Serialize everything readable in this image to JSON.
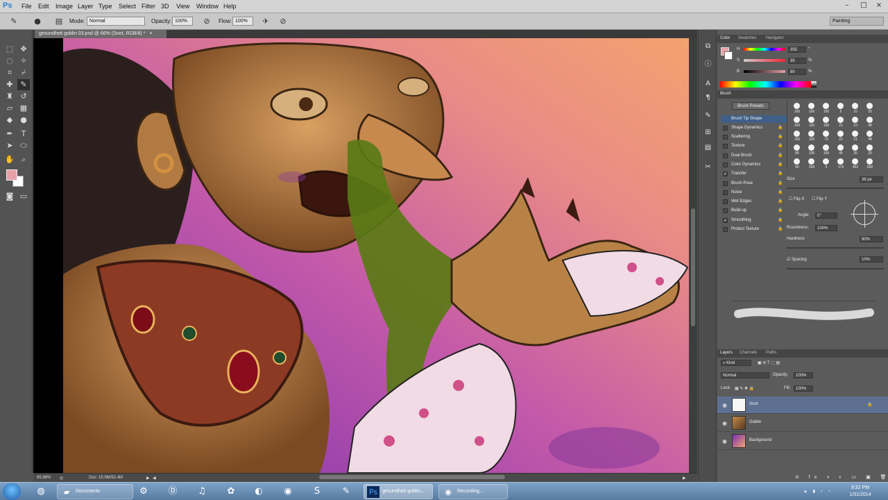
{
  "app": {
    "logo": "Ps"
  },
  "menu": [
    "File",
    "Edit",
    "Image",
    "Layer",
    "Type",
    "Select",
    "Filter",
    "3D",
    "View",
    "Window",
    "Help"
  ],
  "window_controls": {
    "minimize": "–",
    "maximize": "□",
    "close": "×"
  },
  "options_bar": {
    "mode_label": "Mode:",
    "mode_value": "Normal",
    "opacity_label": "Opacity:",
    "opacity_value": "100%",
    "flow_label": "Flow:",
    "flow_value": "100%",
    "workspace": "Painting"
  },
  "document": {
    "tab_title": "gesundheit goblin 03.psd @ 66% (Snot, RGB/8) *",
    "close": "×"
  },
  "status": {
    "zoom": "65.96%",
    "doc_info": "Doc: 15.0M/52.4M"
  },
  "colors": {
    "foreground": "#e8a0a8",
    "background": "#ffffff"
  },
  "color_panel": {
    "tabs": [
      "Color",
      "Swatches",
      "Navigator"
    ],
    "h_label": "H",
    "h_value": "355",
    "h_unit": "°",
    "s_label": "S",
    "s_value": "35",
    "s_unit": "%",
    "b_label": "B",
    "b_value": "80",
    "b_unit": "%"
  },
  "brush_panel": {
    "tab": "Brush",
    "presets_button": "Brush Presets",
    "options": [
      {
        "label": "Brush Tip Shape",
        "checked": null,
        "lock": false
      },
      {
        "label": "Shape Dynamics",
        "checked": false,
        "lock": true
      },
      {
        "label": "Scattering",
        "checked": false,
        "lock": true
      },
      {
        "label": "Texture",
        "checked": false,
        "lock": true
      },
      {
        "label": "Dual Brush",
        "checked": false,
        "lock": true
      },
      {
        "label": "Color Dynamics",
        "checked": false,
        "lock": true
      },
      {
        "label": "Transfer",
        "checked": true,
        "lock": true
      },
      {
        "label": "Brush Pose",
        "checked": false,
        "lock": true
      },
      {
        "label": "Noise",
        "checked": false,
        "lock": true
      },
      {
        "label": "Wet Edges",
        "checked": false,
        "lock": true
      },
      {
        "label": "Build-up",
        "checked": false,
        "lock": true
      },
      {
        "label": "Smoothing",
        "checked": true,
        "lock": true
      },
      {
        "label": "Protect Texture",
        "checked": false,
        "lock": true
      }
    ],
    "preset_sizes": [
      [
        "100",
        "100",
        "100",
        "5",
        "10",
        "25"
      ],
      [
        "100",
        "120",
        "100",
        "21",
        "10",
        "48"
      ],
      [
        "100",
        "100",
        "73",
        "21",
        "21",
        "48"
      ],
      [
        "80",
        "100",
        "100",
        "45",
        "20",
        "20"
      ],
      [
        "60",
        "294",
        "5",
        "173",
        "462",
        "600"
      ]
    ],
    "size_label": "Size",
    "size_value": "36 px",
    "flip_x": "Flip X",
    "flip_y": "Flip Y",
    "angle_label": "Angle:",
    "angle_value": "0°",
    "roundness_label": "Roundness:",
    "roundness_value": "100%",
    "hardness_label": "Hardness",
    "hardness_value": "90%",
    "spacing_label": "Spacing",
    "spacing_value": "10%"
  },
  "layers_panel": {
    "tabs": [
      "Layers",
      "Channels",
      "Paths"
    ],
    "kind": "Kind",
    "blend_mode": "Normal",
    "opacity_label": "Opacity:",
    "opacity_value": "100%",
    "lock_label": "Lock:",
    "fill_label": "Fill:",
    "fill_value": "100%",
    "layers": [
      {
        "name": "Snot",
        "selected": true,
        "locked": true
      },
      {
        "name": "Goblin",
        "selected": false,
        "locked": false
      },
      {
        "name": "Background",
        "selected": false,
        "locked": false
      }
    ]
  },
  "taskbar": {
    "documents_label": "Documents",
    "ps_task_label": "gesundheit goblin...",
    "recording_label": "Recording...",
    "time": "9:32 PM",
    "date": "1/31/2014"
  }
}
